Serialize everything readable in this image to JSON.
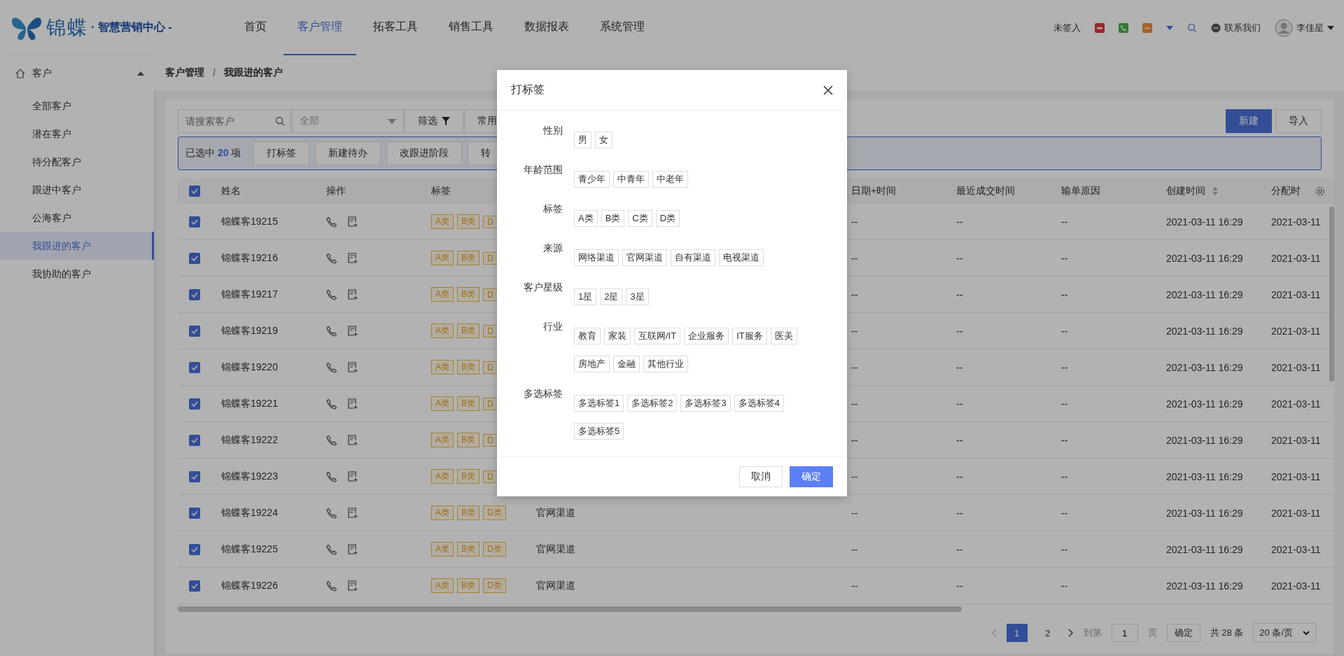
{
  "header": {
    "brand": "锦蝶",
    "subtitle": "· 智慧营销中心 -",
    "nav": [
      {
        "label": "首页",
        "selected": false
      },
      {
        "label": "客户管理",
        "selected": true
      },
      {
        "label": "拓客工具",
        "selected": false
      },
      {
        "label": "销售工具",
        "selected": false
      },
      {
        "label": "数据报表",
        "selected": false
      },
      {
        "label": "系统管理",
        "selected": false
      }
    ],
    "status": "未签入",
    "contact": "联系我们",
    "user": "李佳星"
  },
  "sidebar": {
    "group": {
      "label": "客户",
      "expanded": true
    },
    "items": [
      {
        "label": "全部客户",
        "selected": false
      },
      {
        "label": "潜在客户",
        "selected": false
      },
      {
        "label": "待分配客户",
        "selected": false
      },
      {
        "label": "跟进中客户",
        "selected": false
      },
      {
        "label": "公海客户",
        "selected": false
      },
      {
        "label": "我跟进的客户",
        "selected": true
      },
      {
        "label": "我协助的客户",
        "selected": false
      }
    ]
  },
  "breadcrumb": [
    "客户管理",
    "我跟进的客户"
  ],
  "breadcrumb_separator": "/",
  "toolbar": {
    "search_placeholder": "请搜索客户",
    "select_value": "全部",
    "filter": "筛选",
    "common_filter": "常用",
    "actions": [
      "新建",
      "导入"
    ]
  },
  "batch": {
    "prefix": "已选中",
    "count": "20",
    "suffix": "项",
    "buttons": [
      "打标签",
      "新建待办",
      "改跟进阶段",
      "转"
    ]
  },
  "table": {
    "all_checked": true,
    "columns": [
      {
        "label": "姓名"
      },
      {
        "label": "操作"
      },
      {
        "label": "标签"
      },
      {
        "label": "日期+时间"
      },
      {
        "label": "最近成交时间"
      },
      {
        "label": "输单原因"
      },
      {
        "label": "创建时间",
        "sortable": true
      },
      {
        "label": "分配时"
      }
    ],
    "rows": [
      {
        "checked": true,
        "name": "锦蝶客19215",
        "tags": [
          "A类",
          "B类",
          "D"
        ],
        "date": "--",
        "last_deal": "--",
        "lost_reason": "--",
        "created": "2021-03-11 16:29",
        "assigned": "2021-03-11"
      },
      {
        "checked": true,
        "name": "锦蝶客19216",
        "tags": [
          "A类",
          "B类",
          "D"
        ],
        "date": "--",
        "last_deal": "--",
        "lost_reason": "--",
        "created": "2021-03-11 16:29",
        "assigned": "2021-03-11"
      },
      {
        "checked": true,
        "name": "锦蝶客19217",
        "tags": [
          "A类",
          "B类",
          "D"
        ],
        "date": "--",
        "last_deal": "--",
        "lost_reason": "--",
        "created": "2021-03-11 16:29",
        "assigned": "2021-03-11"
      },
      {
        "checked": true,
        "name": "锦蝶客19219",
        "tags": [
          "A类",
          "B类",
          "D"
        ],
        "date": "--",
        "last_deal": "--",
        "lost_reason": "--",
        "created": "2021-03-11 16:29",
        "assigned": "2021-03-11"
      },
      {
        "checked": true,
        "name": "锦蝶客19220",
        "tags": [
          "A类",
          "B类",
          "D"
        ],
        "date": "--",
        "last_deal": "--",
        "lost_reason": "--",
        "created": "2021-03-11 16:29",
        "assigned": "2021-03-11"
      },
      {
        "checked": true,
        "name": "锦蝶客19221",
        "tags": [
          "A类",
          "B类",
          "D"
        ],
        "date": "--",
        "last_deal": "--",
        "lost_reason": "--",
        "created": "2021-03-11 16:29",
        "assigned": "2021-03-11"
      },
      {
        "checked": true,
        "name": "锦蝶客19222",
        "tags": [
          "A类",
          "B类",
          "D"
        ],
        "date": "--",
        "last_deal": "--",
        "lost_reason": "--",
        "created": "2021-03-11 16:29",
        "assigned": "2021-03-11"
      },
      {
        "checked": true,
        "name": "锦蝶客19223",
        "tags": [
          "A类",
          "B类",
          "D"
        ],
        "date": "--",
        "last_deal": "--",
        "lost_reason": "--",
        "created": "2021-03-11 16:29",
        "assigned": "2021-03-11"
      },
      {
        "checked": true,
        "name": "锦蝶客19224",
        "tags": [
          "A类",
          "B类",
          "D类"
        ],
        "source": "官网渠道",
        "date": "--",
        "last_deal": "--",
        "lost_reason": "--",
        "created": "2021-03-11 16:29",
        "assigned": "2021-03-11"
      },
      {
        "checked": true,
        "name": "锦蝶客19225",
        "tags": [
          "A类",
          "B类",
          "D类"
        ],
        "source": "官网渠道",
        "date": "--",
        "last_deal": "--",
        "lost_reason": "--",
        "created": "2021-03-11 16:29",
        "assigned": "2021-03-11"
      },
      {
        "checked": true,
        "name": "锦蝶客19226",
        "tags": [
          "A类",
          "B类",
          "D类"
        ],
        "source": "官网渠道",
        "date": "--",
        "last_deal": "--",
        "lost_reason": "--",
        "created": "2021-03-11 16:29",
        "assigned": "2021-03-11"
      }
    ]
  },
  "pagination": {
    "pages": [
      {
        "label": "1",
        "selected": true
      },
      {
        "label": "2",
        "selected": false
      }
    ],
    "goto_prefix": "到第",
    "goto_value": "1",
    "goto_suffix": "页",
    "confirm": "确定",
    "total": "共 28 条",
    "page_size": "20 条/页"
  },
  "dialog": {
    "title": "打标签",
    "groups": [
      {
        "label": "性别",
        "tags": [
          "男",
          "女"
        ]
      },
      {
        "label": "年龄范围",
        "tags": [
          "青少年",
          "中青年",
          "中老年"
        ]
      },
      {
        "label": "标签",
        "tags": [
          "A类",
          "B类",
          "C类",
          "D类"
        ]
      },
      {
        "label": "来源",
        "tags": [
          "网络渠道",
          "官网渠道",
          "自有渠道",
          "电视渠道"
        ]
      },
      {
        "label": "客户星级",
        "tags": [
          "1星",
          "2星",
          "3星"
        ]
      },
      {
        "label": "行业",
        "tags": [
          "教育",
          "家装",
          "互联网/IT",
          "企业服务",
          "IT服务",
          "医美",
          "房地产",
          "金融",
          "其他行业"
        ]
      },
      {
        "label": "多选标签",
        "tags": [
          "多选标签1",
          "多选标签2",
          "多选标签3",
          "多选标签4",
          "多选标签5"
        ]
      }
    ],
    "cancel": "取消",
    "ok": "确定"
  }
}
